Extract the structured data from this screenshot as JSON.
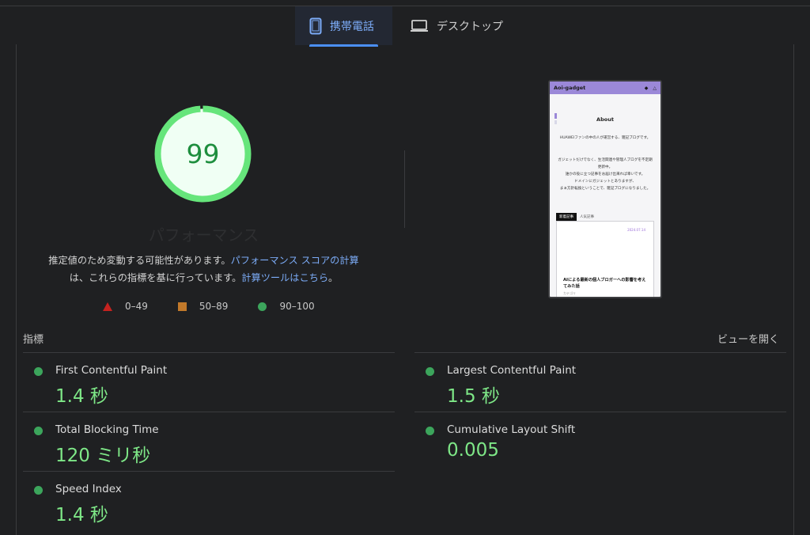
{
  "tabs": [
    {
      "label": "携帯電話",
      "icon": "mobile-phone-icon",
      "active": true
    },
    {
      "label": "デスクトップ",
      "icon": "laptop-icon",
      "active": false
    }
  ],
  "score": {
    "value": "99",
    "fraction": 0.99,
    "title": "パフォーマンス",
    "color": "#1e8e3e",
    "ring_color": "#66e57b",
    "fill_color": "#f0fff4"
  },
  "description": {
    "part1": "推定値のため変動する可能性があります。",
    "link1": "パフォーマンス スコアの計算",
    "part2": "は、これらの指標を基に行っています。",
    "link2": "計算ツールはこちら",
    "end": "。"
  },
  "legend": [
    {
      "label": "0–49",
      "shape": "triangle",
      "color": "#c5221f"
    },
    {
      "label": "50–89",
      "shape": "square",
      "color": "#c2792a"
    },
    {
      "label": "90–100",
      "shape": "circle",
      "color": "#3ca55c"
    }
  ],
  "screenshot": {
    "site_name": "Aoi-gadget",
    "heading": "About",
    "line1": "HUAWEIファンの中の人が運営する、雑記ブログです。",
    "line2": "ガジェットだけでなく、生活関連や管理人ブログを不定期更新中。",
    "line3": "誰かの役に立つ記事をお届け出来れば幸いです。",
    "line4": "ドメインにガジェットとありますが、",
    "line5": "まぁ方針転換ということで、雑記ブログになりました。",
    "tab_new": "新着記事",
    "tab_popular": "人気記事",
    "card_date": "2024.07.14",
    "card_title": "AIによる最新の個人ブロガーへの影響を考えてみた話",
    "card_sub": "カテゴリ"
  },
  "metrics_section": {
    "label": "指標",
    "toggle": "ビューを開く"
  },
  "metrics": [
    {
      "name": "First Contentful Paint",
      "value": "1.4 秒"
    },
    {
      "name": "Largest Contentful Paint",
      "value": "1.5 秒"
    },
    {
      "name": "Total Blocking Time",
      "value": "120 ミリ秒"
    },
    {
      "name": "Cumulative Layout Shift",
      "value": "0.005"
    },
    {
      "name": "Speed Index",
      "value": "1.4 秒"
    }
  ]
}
